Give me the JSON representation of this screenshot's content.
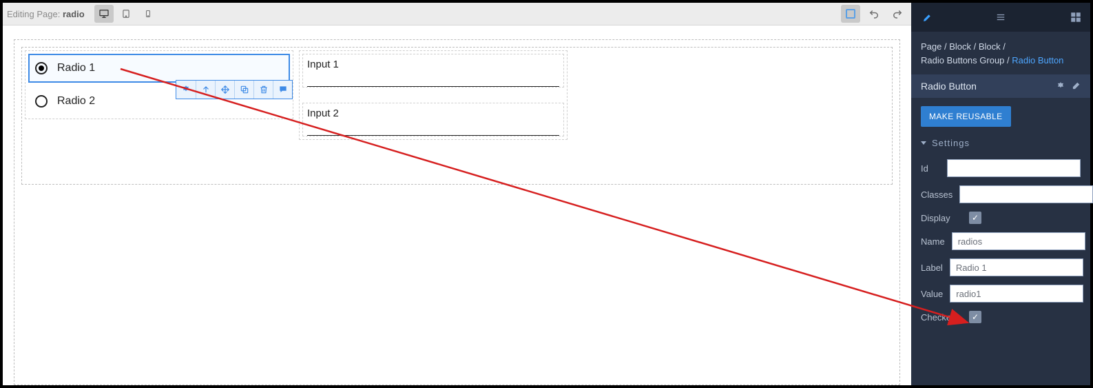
{
  "topbar": {
    "editing_prefix": "Editing Page: ",
    "page_name": "radio"
  },
  "canvas": {
    "radio1_label": "Radio 1",
    "radio2_label": "Radio 2",
    "input1_label": "Input 1",
    "input2_label": "Input 2"
  },
  "sidebar": {
    "breadcrumb": {
      "seg1": "Page",
      "seg2": "Block",
      "seg3": "Block",
      "seg4": "Radio Buttons Group",
      "seg5": "Radio Button",
      "sep": " / "
    },
    "panel_title": "Radio Button",
    "make_reusable": "MAKE REUSABLE",
    "section_settings": "Settings",
    "props": {
      "id": {
        "label": "Id",
        "value": ""
      },
      "classes": {
        "label": "Classes",
        "value": ""
      },
      "display": {
        "label": "Display",
        "checked": true
      },
      "name": {
        "label": "Name",
        "value": "radios"
      },
      "label": {
        "label": "Label",
        "value": "Radio 1"
      },
      "value": {
        "label": "Value",
        "value": "radio1"
      },
      "checked": {
        "label": "Checked",
        "checked": true
      }
    }
  }
}
